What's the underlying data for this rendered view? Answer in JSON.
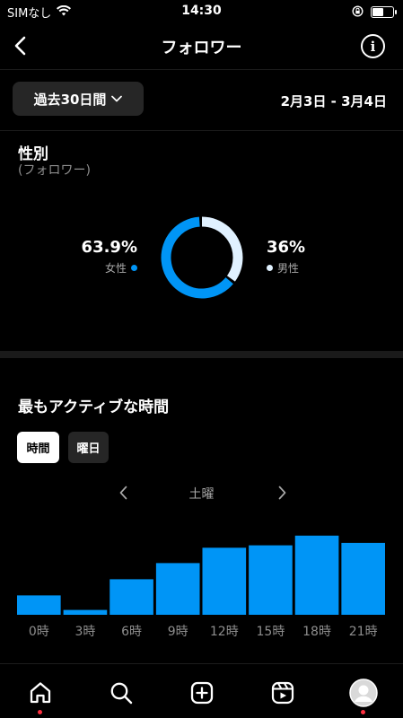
{
  "status_bar": {
    "carrier": "SIMなし",
    "time": "14:30",
    "battery_level": 0.55
  },
  "header": {
    "title": "フォロワー"
  },
  "filter": {
    "range_label": "過去30日間",
    "date_range": "2月3日 - 3月4日"
  },
  "gender": {
    "title": "性別",
    "subtitle": "(フォロワー)",
    "female": {
      "percent": "63.9%",
      "label": "女性",
      "value": 63.9,
      "color": "#0095f6"
    },
    "male": {
      "percent": "36%",
      "label": "男性",
      "value": 36.1,
      "color": "#e0f1ff"
    }
  },
  "active_times": {
    "title": "最もアクティブな時間",
    "tabs": {
      "hours": "時間",
      "days": "曜日"
    },
    "day": "土曜"
  },
  "chart_data": {
    "type": "bar",
    "categories": [
      "0時",
      "3時",
      "6時",
      "9時",
      "12時",
      "15時",
      "18時",
      "21時"
    ],
    "values": [
      24,
      6,
      44,
      64,
      83,
      86,
      98,
      89
    ],
    "ylim": [
      0,
      100
    ],
    "color": "#0095f6",
    "grid": false
  },
  "colors": {
    "accent": "#0095f6",
    "background": "#000000",
    "notification": "#ff3040"
  },
  "bottom_nav": {
    "items": [
      "home-icon",
      "search-icon",
      "create-icon",
      "reels-icon",
      "profile-avatar"
    ]
  }
}
